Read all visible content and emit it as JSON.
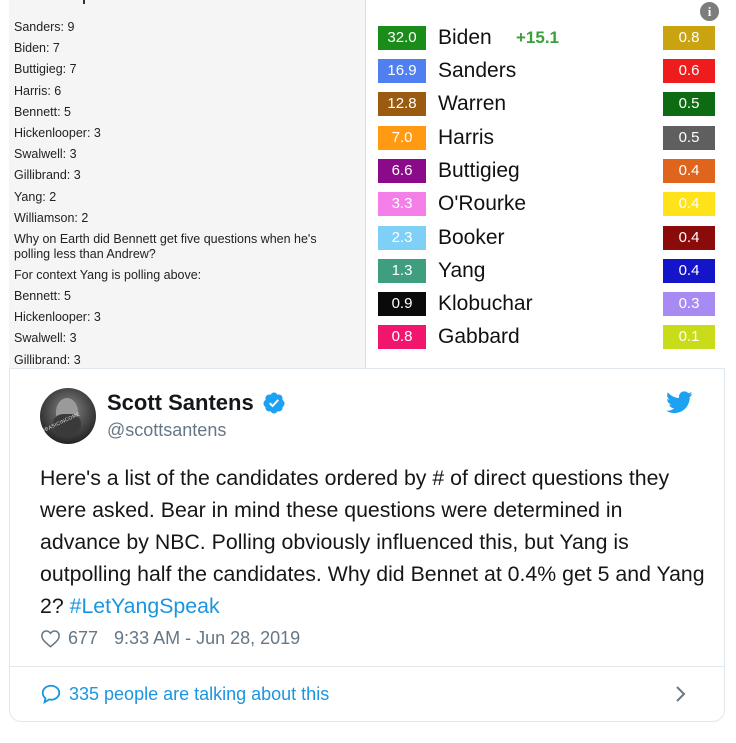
{
  "media": {
    "left_lines": [
      "Sanders: 9",
      "Biden: 7",
      "Buttigieg: 7",
      "Harris: 6",
      "Bennett: 5",
      "Hickenlooper: 3",
      "Swalwell: 3",
      "Gillibrand: 3",
      "Yang: 2",
      "Williamson: 2",
      "Why on Earth did Bennett get five questions when he's\npolling less than Andrew?",
      "For context Yang is polling above:",
      "Bennett: 5",
      "Hickenlooper: 3",
      "Swalwell: 3",
      "Gillibrand: 3"
    ],
    "rows": [
      {
        "pct": "32.0",
        "name": "Biden",
        "delta": "+15.1",
        "odds": "0.8",
        "pct_color": "#1a8c1a",
        "odds_color": "#c9a310"
      },
      {
        "pct": "16.9",
        "name": "Sanders",
        "delta": "",
        "odds": "0.6",
        "pct_color": "#4f7ff0",
        "odds_color": "#ee1c1c"
      },
      {
        "pct": "12.8",
        "name": "Warren",
        "delta": "",
        "odds": "0.5",
        "pct_color": "#9a5a10",
        "odds_color": "#0d6b12"
      },
      {
        "pct": "7.0",
        "name": "Harris",
        "delta": "",
        "odds": "0.5",
        "pct_color": "#ff9a12",
        "odds_color": "#5f5f5f"
      },
      {
        "pct": "6.6",
        "name": "Buttigieg",
        "delta": "",
        "odds": "0.4",
        "pct_color": "#8a0a8a",
        "odds_color": "#e0651c"
      },
      {
        "pct": "3.3",
        "name": "O'Rourke",
        "delta": "",
        "odds": "0.4",
        "pct_color": "#f47fe8",
        "odds_color": "#ffe21a"
      },
      {
        "pct": "2.3",
        "name": "Booker",
        "delta": "",
        "odds": "0.4",
        "pct_color": "#7fd0f6",
        "odds_color": "#8b0a0a"
      },
      {
        "pct": "1.3",
        "name": "Yang",
        "delta": "",
        "odds": "0.4",
        "pct_color": "#3f9e7f",
        "odds_color": "#1414c8"
      },
      {
        "pct": "0.9",
        "name": "Klobuchar",
        "delta": "",
        "odds": "0.3",
        "pct_color": "#0a0a0a",
        "odds_color": "#a78af2"
      },
      {
        "pct": "0.8",
        "name": "Gabbard",
        "delta": "",
        "odds": "0.1",
        "pct_color": "#f2156e",
        "odds_color": "#c9dc1a"
      }
    ]
  },
  "author": {
    "display_name": "Scott Santens",
    "handle": "@scottsantens",
    "avatar_stamp": "#BASICINCOME"
  },
  "tweet": {
    "text": "Here's a list of the candidates ordered by # of direct questions they were asked. Bear in mind these questions were determined in advance by NBC. Polling obviously influenced this, but Yang is outpolling half the candidates. Why did Bennet at 0.4% get 5 and Yang 2? ",
    "hashtag": "#LetYangSpeak",
    "likes": "677",
    "timestamp": "9:33 AM - Jun 28, 2019"
  },
  "footer": {
    "talking_label": "335 people are talking about this"
  },
  "icons": {
    "verified": "verified-badge-icon",
    "twitter": "twitter-bird-icon",
    "heart": "heart-outline-icon",
    "bubble": "speech-bubble-icon",
    "chevron": "chevron-right-icon",
    "info": "info-icon"
  },
  "colors": {
    "link": "#1b95e0",
    "verified": "#1da1f2",
    "secondary_text": "#657786",
    "delta_green": "#3aa13a"
  }
}
